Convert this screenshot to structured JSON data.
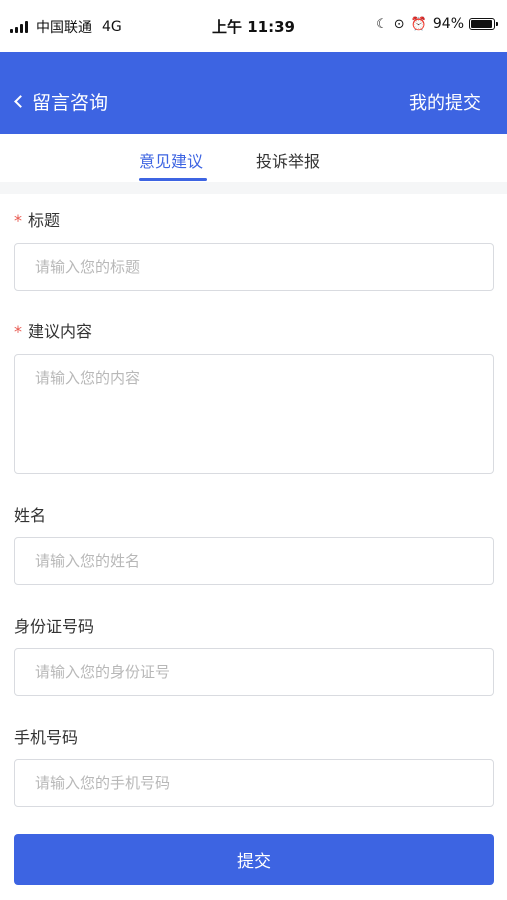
{
  "status_bar": {
    "carrier": "中国联通",
    "network": "4G",
    "time": "上午 11:39",
    "battery": "94%",
    "battery_level": 0.94,
    "icons": [
      "signal-icon",
      "moon-icon",
      "orientation-lock-icon",
      "alarm-icon",
      "battery-icon"
    ]
  },
  "nav": {
    "back_label": "留言咨询",
    "action_label": "我的提交"
  },
  "tabs": [
    {
      "label": "意见建议",
      "active": true
    },
    {
      "label": "投诉举报",
      "active": false
    }
  ],
  "form": {
    "title": {
      "label": "标题",
      "required_mark": "*",
      "placeholder": "请输入您的标题",
      "value": ""
    },
    "content": {
      "label": "建议内容",
      "required_mark": "*",
      "placeholder": "请输入您的内容",
      "value": ""
    },
    "name": {
      "label": "姓名",
      "placeholder": "请输入您的姓名",
      "value": ""
    },
    "id_number": {
      "label": "身份证号码",
      "placeholder": "请输入您的身份证号",
      "value": ""
    },
    "phone": {
      "label": "手机号码",
      "placeholder": "请输入您的手机号码",
      "value": ""
    }
  },
  "submit_label": "提交",
  "colors": {
    "primary": "#3d64e2",
    "required": "#e8584f",
    "placeholder": "#b8b8b8"
  }
}
